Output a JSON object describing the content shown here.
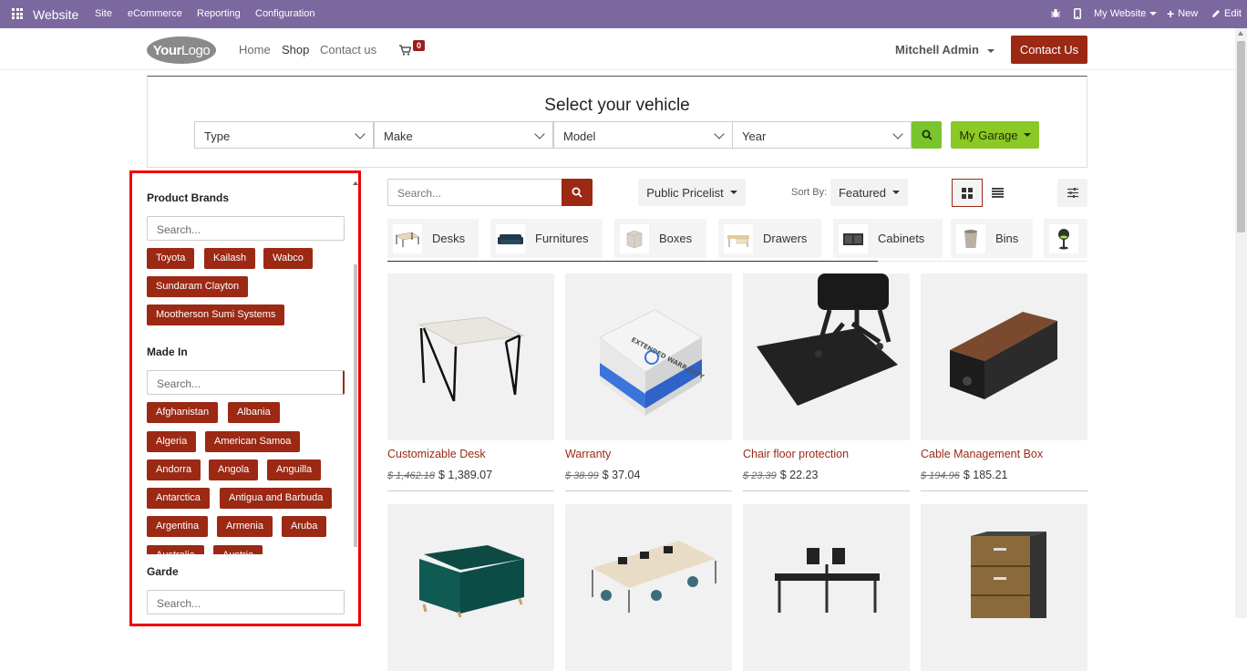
{
  "topbar": {
    "brand": "Website",
    "menu": [
      "Site",
      "eCommerce",
      "Reporting",
      "Configuration"
    ],
    "my_website": "My Website",
    "new": "New",
    "edit": "Edit"
  },
  "navbar": {
    "logo_bold": "Your",
    "logo_light": "Logo",
    "links": [
      "Home",
      "Shop",
      "Contact us"
    ],
    "cart_count": "0",
    "user": "Mitchell Admin",
    "contact_button": "Contact Us"
  },
  "vehicle": {
    "title": "Select your vehicle",
    "selects": [
      "Type",
      "Make",
      "Model",
      "Year"
    ],
    "garage": "My Garage"
  },
  "filters": {
    "brands_title": "Product Brands",
    "brands_search": "Search...",
    "brands": [
      "Toyota",
      "Kailash",
      "Wabco",
      "Sundaram Clayton",
      "Mootherson Sumi Systems"
    ],
    "made_in_title": "Made In",
    "made_in_search": "Search...",
    "countries": [
      "Afghanistan",
      "Albania",
      "Algeria",
      "American Samoa",
      "Andorra",
      "Angola",
      "Anguilla",
      "Antarctica",
      "Antigua and Barbuda",
      "Argentina",
      "Armenia",
      "Aruba",
      "Australia",
      "Austria"
    ],
    "garde_title": "Garde",
    "garde_search": "Search..."
  },
  "toolbar": {
    "search_placeholder": "Search...",
    "pricelist": "Public Pricelist",
    "sort_label": "Sort By:",
    "sort_value": "Featured"
  },
  "categories": [
    "Desks",
    "Furnitures",
    "Boxes",
    "Drawers",
    "Cabinets",
    "Bins"
  ],
  "products": [
    {
      "name": "Customizable Desk",
      "old_price": "$ 1,462.18",
      "price": "$ 1,389.07"
    },
    {
      "name": "Warranty",
      "old_price": "$ 38.99",
      "price": "$ 37.04"
    },
    {
      "name": "Chair floor protection",
      "old_price": "$ 23.39",
      "price": "$ 22.23"
    },
    {
      "name": "Cable Management Box",
      "old_price": "$ 194.96",
      "price": "$ 185.21"
    }
  ],
  "warranty_box_text": "EXTENDED WARRANTY",
  "colors": {
    "topbar": "#7b689f",
    "accent": "#9b2914",
    "green": "#8bc926"
  }
}
